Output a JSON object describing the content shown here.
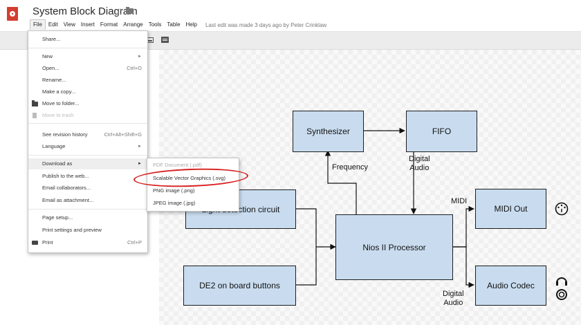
{
  "header": {
    "title": "System Block Diagram",
    "star_icon": "star-icon",
    "folder_icon": "folder-icon",
    "menus": [
      "File",
      "Edit",
      "View",
      "Insert",
      "Format",
      "Arrange",
      "Tools",
      "Table",
      "Help"
    ],
    "last_edit": "Last edit was made 3 days ago by Peter Crinklaw"
  },
  "file_menu": {
    "items": [
      {
        "label": "Share...",
        "shortcut": "",
        "submenu": false,
        "disabled": false,
        "icon": ""
      },
      {
        "label": "New",
        "shortcut": "",
        "submenu": true,
        "disabled": false,
        "icon": ""
      },
      {
        "label": "Open...",
        "shortcut": "Ctrl+O",
        "submenu": false,
        "disabled": false,
        "icon": ""
      },
      {
        "label": "Rename...",
        "shortcut": "",
        "submenu": false,
        "disabled": false,
        "icon": ""
      },
      {
        "label": "Make a copy...",
        "shortcut": "",
        "submenu": false,
        "disabled": false,
        "icon": ""
      },
      {
        "label": "Move to folder...",
        "shortcut": "",
        "submenu": false,
        "disabled": false,
        "icon": "folder-icon"
      },
      {
        "label": "Move to trash",
        "shortcut": "",
        "submenu": false,
        "disabled": true,
        "icon": "trash-icon"
      },
      {
        "label": "See revision history",
        "shortcut": "Ctrl+Alt+Shift+G",
        "submenu": false,
        "disabled": false,
        "icon": ""
      },
      {
        "label": "Language",
        "shortcut": "",
        "submenu": true,
        "disabled": false,
        "icon": ""
      },
      {
        "label": "Download as",
        "shortcut": "",
        "submenu": true,
        "disabled": false,
        "icon": ""
      },
      {
        "label": "Publish to the web...",
        "shortcut": "",
        "submenu": false,
        "disabled": false,
        "icon": ""
      },
      {
        "label": "Email collaborators...",
        "shortcut": "",
        "submenu": false,
        "disabled": false,
        "icon": ""
      },
      {
        "label": "Email as attachment...",
        "shortcut": "",
        "submenu": false,
        "disabled": false,
        "icon": ""
      },
      {
        "label": "Page setup...",
        "shortcut": "",
        "submenu": false,
        "disabled": false,
        "icon": ""
      },
      {
        "label": "Print settings and preview",
        "shortcut": "",
        "submenu": false,
        "disabled": false,
        "icon": ""
      },
      {
        "label": "Print",
        "shortcut": "Ctrl+P",
        "submenu": false,
        "disabled": false,
        "icon": "printer-icon"
      }
    ],
    "submenu_arrow": "►"
  },
  "download_submenu": {
    "items": [
      "PDF Document (.pdf)",
      "Scalable Vector Graphics (.svg)",
      "PNG image (.png)",
      "JPEG image (.jpg)"
    ]
  },
  "diagram": {
    "nodes": {
      "synthesizer": "Synthesizer",
      "fifo": "FIFO",
      "light_detection": "Light detection circuit",
      "nios": "Nios II Processor",
      "midi_out": "MIDI Out",
      "buttons": "DE2 on board buttons",
      "audio_codec": "Audio Codec"
    },
    "labels": {
      "frequency": "Frequency",
      "digital_audio_top": "Digital\nAudio",
      "midi": "MIDI",
      "digital_audio_bottom": "Digital\nAudio"
    }
  },
  "colors": {
    "accent": "#d23f31",
    "node_fill": "#c9dcef",
    "highlight_circle": "#d81e1e"
  }
}
